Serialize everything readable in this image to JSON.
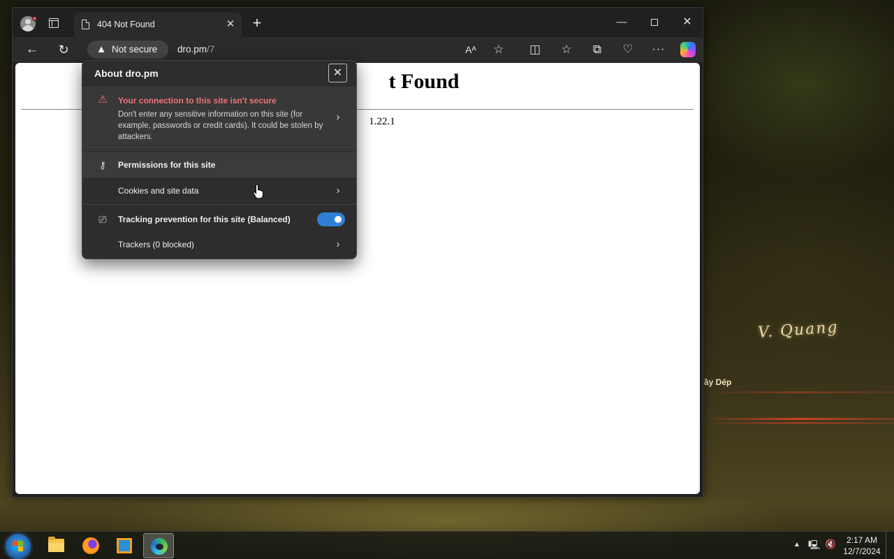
{
  "browser": {
    "tab": {
      "title": "404 Not Found"
    },
    "window_controls": {
      "minimize": "—",
      "close": "✕"
    },
    "toolbar": {
      "security_label": "Not secure",
      "address_host": "dro.pm",
      "address_path": "/7"
    }
  },
  "page": {
    "heading_partial": "t Found",
    "server_partial": "1.22.1"
  },
  "site_info_popup": {
    "title": "About dro.pm",
    "connection": {
      "title": "Your connection to this site isn't secure",
      "description": "Don't enter any sensitive information on this site (for example, passwords or credit cards). It could be stolen by attackers."
    },
    "permissions_label": "Permissions for this site",
    "cookies_label": "Cookies and site data",
    "tracking_label": "Tracking prevention for this site (Balanced)",
    "tracking_enabled": true,
    "trackers_label": "Trackers (0 blocked)"
  },
  "desktop": {
    "wallpaper_sign": "V. Quang",
    "wallpaper_small": "ầy Dép"
  },
  "taskbar": {
    "time": "2:17 AM",
    "date": "12/7/2024"
  },
  "colors": {
    "warning": "#f1707b",
    "toggle_on": "#2f7fd4"
  }
}
